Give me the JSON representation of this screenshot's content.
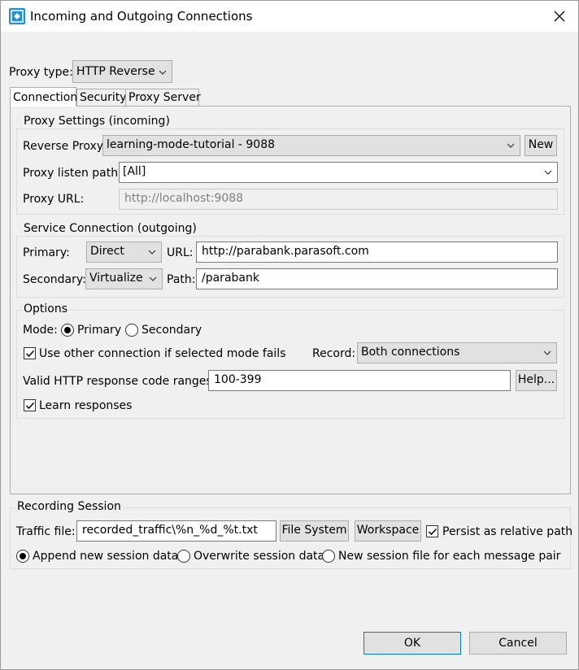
{
  "window": {
    "title": "Incoming and Outgoing Connections"
  },
  "proxy_type": {
    "label": "Proxy type:",
    "value": "HTTP Reverse"
  },
  "tabs": [
    {
      "label": "Connection"
    },
    {
      "label": "Security"
    },
    {
      "label": "Proxy Server"
    }
  ],
  "proxy_settings": {
    "title": "Proxy Settings (incoming)",
    "reverse_proxy_label": "Reverse Proxy:",
    "reverse_proxy_value": "learning-mode-tutorial - 9088",
    "new_button": "New",
    "listen_path_label": "Proxy listen path:",
    "listen_path_value": "[All]",
    "proxy_url_label": "Proxy URL:",
    "proxy_url_value": "http://localhost:9088"
  },
  "service_connection": {
    "title": "Service Connection (outgoing)",
    "primary_label": "Primary:",
    "primary_value": "Direct",
    "url_label": "URL:",
    "url_value": "http://parabank.parasoft.com",
    "secondary_label": "Secondary:",
    "secondary_value": "Virtualize",
    "path_label": "Path:",
    "path_value": "/parabank"
  },
  "options": {
    "title": "Options",
    "mode_label": "Mode:",
    "mode_primary": "Primary",
    "mode_secondary": "Secondary",
    "use_other_label": "Use other connection if selected mode fails",
    "record_label": "Record:",
    "record_value": "Both connections",
    "valid_codes_label": "Valid HTTP response code ranges:",
    "valid_codes_value": "100-399",
    "help_button": "Help...",
    "learn_label": "Learn responses"
  },
  "recording": {
    "title": "Recording Session",
    "traffic_label": "Traffic file:",
    "traffic_value": "recorded_traffic\\%n_%d_%t.txt",
    "file_system_button": "File System",
    "workspace_button": "Workspace",
    "persist_label": "Persist as relative path",
    "append_label": "Append new session data",
    "overwrite_label": "Overwrite session data",
    "new_file_label": "New session file for each message pair"
  },
  "footer": {
    "ok": "OK",
    "cancel": "Cancel"
  },
  "colors": {
    "accent": "#0078d7",
    "title_bg": "#ffffff",
    "dialog_bg": "#f0f0f0"
  }
}
